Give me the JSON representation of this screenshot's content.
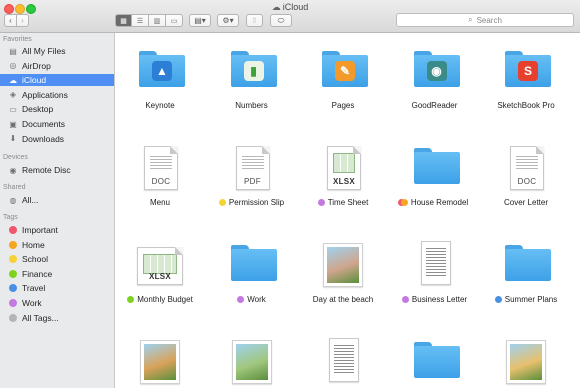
{
  "window": {
    "title": "iCloud"
  },
  "toolbar": {
    "back": "‹",
    "forward": "›",
    "search_placeholder": "Search"
  },
  "sidebar": {
    "favorites_header": "Favorites",
    "favorites": [
      {
        "label": "All My Files",
        "icon": "all-files-icon",
        "selected": false
      },
      {
        "label": "AirDrop",
        "icon": "airdrop-icon",
        "selected": false
      },
      {
        "label": "iCloud",
        "icon": "cloud-icon",
        "selected": true
      },
      {
        "label": "Applications",
        "icon": "applications-icon",
        "selected": false
      },
      {
        "label": "Desktop",
        "icon": "desktop-icon",
        "selected": false
      },
      {
        "label": "Documents",
        "icon": "documents-icon",
        "selected": false
      },
      {
        "label": "Downloads",
        "icon": "downloads-icon",
        "selected": false
      }
    ],
    "devices_header": "Devices",
    "devices": [
      {
        "label": "Remote Disc",
        "icon": "disc-icon"
      }
    ],
    "shared_header": "Shared",
    "shared": [
      {
        "label": "All...",
        "icon": "network-icon"
      }
    ],
    "tags_header": "Tags",
    "tags": [
      {
        "label": "Important",
        "color": "#f0576a"
      },
      {
        "label": "Home",
        "color": "#f5a623"
      },
      {
        "label": "School",
        "color": "#f7d235"
      },
      {
        "label": "Finance",
        "color": "#7ed321"
      },
      {
        "label": "Travel",
        "color": "#4a90e2"
      },
      {
        "label": "Work",
        "color": "#c479e0"
      },
      {
        "label": "All Tags...",
        "color": "#b5b5b5"
      }
    ]
  },
  "files": [
    {
      "name": "Keynote",
      "kind": "folder-app",
      "emblem": "keynote"
    },
    {
      "name": "Numbers",
      "kind": "folder-app",
      "emblem": "numbers"
    },
    {
      "name": "Pages",
      "kind": "folder-app",
      "emblem": "pages"
    },
    {
      "name": "GoodReader",
      "kind": "folder-app",
      "emblem": "goodreader"
    },
    {
      "name": "SketchBook Pro",
      "kind": "folder-app",
      "emblem": "sketchbook",
      "emblem_text": "S"
    },
    {
      "name": "Menu",
      "kind": "doc",
      "ext": "DOC"
    },
    {
      "name": "Permission Slip",
      "kind": "doc",
      "ext": "PDF",
      "tag": "#f7d235"
    },
    {
      "name": "Time Sheet",
      "kind": "sheet",
      "ext": "XLSX",
      "tag": "#c479e0"
    },
    {
      "name": "House Remodel",
      "kind": "folder",
      "tag": "#f5a623",
      "tag2": "#f0576a"
    },
    {
      "name": "Cover Letter",
      "kind": "doc",
      "ext": "DOC"
    },
    {
      "name": "Monthly Budget",
      "kind": "sheet-wide",
      "ext": "XLSX",
      "tag": "#7ed321"
    },
    {
      "name": "Work",
      "kind": "folder",
      "tag": "#c479e0"
    },
    {
      "name": "Day at the beach",
      "kind": "photo"
    },
    {
      "name": "Business Letter",
      "kind": "letter",
      "tag": "#c479e0"
    },
    {
      "name": "Summer Plans",
      "kind": "folder",
      "tag": "#4a90e2"
    },
    {
      "name": "",
      "kind": "photo"
    },
    {
      "name": "",
      "kind": "photo"
    },
    {
      "name": "",
      "kind": "letter"
    },
    {
      "name": "",
      "kind": "folder"
    },
    {
      "name": "",
      "kind": "photo"
    }
  ]
}
